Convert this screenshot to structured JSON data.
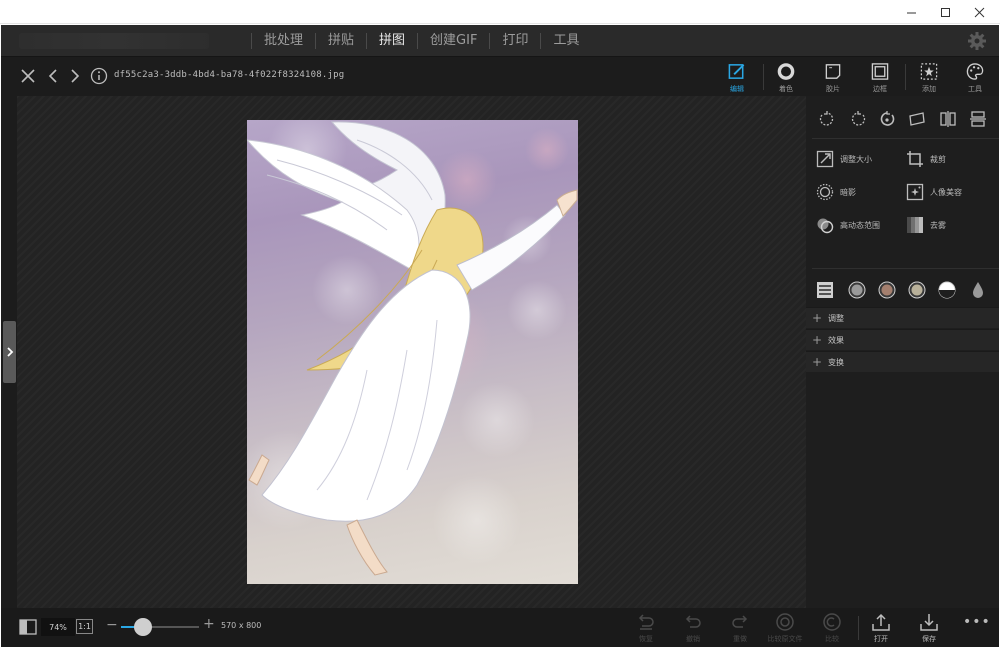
{
  "window": {
    "controls": [
      "minimize",
      "maximize",
      "close"
    ]
  },
  "menu": {
    "items": [
      {
        "label": "批处理",
        "active": false
      },
      {
        "label": "拼贴",
        "active": false
      },
      {
        "label": "拼图",
        "active": true
      },
      {
        "label": "创建GIF",
        "active": false
      },
      {
        "label": "打印",
        "active": false
      },
      {
        "label": "工具",
        "active": false
      }
    ]
  },
  "toolbar": {
    "filename": "df55c2a3-3ddb-4bd4-ba78-4f022f8324108.jpg",
    "tools": [
      {
        "label": "编辑",
        "icon": "edit-icon",
        "active": true
      },
      {
        "label": "着色",
        "icon": "ring-icon",
        "active": false
      },
      {
        "label": "胶片",
        "icon": "film-icon",
        "active": false
      },
      {
        "label": "边框",
        "icon": "frame-icon",
        "active": false
      },
      {
        "label": "添加",
        "icon": "add-star-icon",
        "active": false
      },
      {
        "label": "工具",
        "icon": "palette-icon",
        "active": false
      }
    ]
  },
  "panel": {
    "options": [
      {
        "label": "调整大小",
        "icon": "resize-icon"
      },
      {
        "label": "裁剪",
        "icon": "crop-icon"
      },
      {
        "label": "暗影",
        "icon": "vignette-icon"
      },
      {
        "label": "人像美容",
        "icon": "portrait-beauty-icon"
      },
      {
        "label": "高动态范围",
        "icon": "hdr-icon"
      },
      {
        "label": "去雾",
        "icon": "dehaze-icon"
      }
    ],
    "sections": [
      {
        "label": "调整"
      },
      {
        "label": "效果"
      },
      {
        "label": "变换"
      }
    ]
  },
  "bottom": {
    "zoom": "74%",
    "one_to_one": "1:1",
    "zoom_fraction": 0.28,
    "dimensions": "570 x 800",
    "actions": [
      {
        "label": "恢复",
        "icon": "restore-icon",
        "enabled": false
      },
      {
        "label": "撤销",
        "icon": "undo-icon",
        "enabled": false
      },
      {
        "label": "重做",
        "icon": "redo-icon",
        "enabled": false
      },
      {
        "label": "比较原文件",
        "icon": "compare-icon",
        "enabled": false
      },
      {
        "label": "比较",
        "icon": "compare-alt-icon",
        "enabled": false
      },
      {
        "label": "打开",
        "icon": "open-icon",
        "enabled": true
      },
      {
        "label": "保存",
        "icon": "save-icon",
        "enabled": true
      }
    ],
    "more": "•••"
  },
  "colors": {
    "accent": "#2aa7e4",
    "background": "#1c1c1c",
    "panel": "#1e1e1e"
  }
}
